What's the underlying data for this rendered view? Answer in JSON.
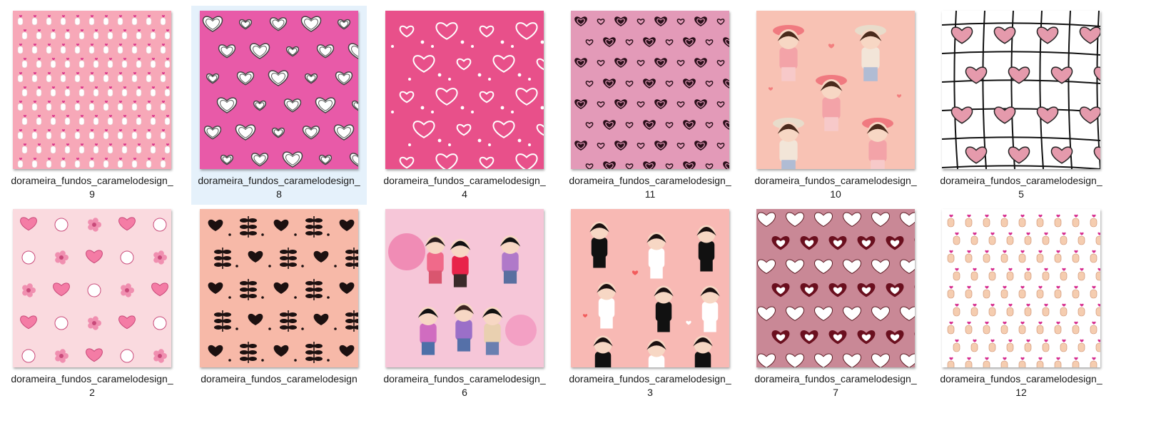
{
  "files": [
    {
      "name": "dorameira_fundos_caramelodesign_",
      "suffix": "9",
      "pattern": "finger-hearts-pink",
      "bg": "#f7a8b8",
      "selected": false
    },
    {
      "name": "dorameira_fundos_caramelodesign_",
      "suffix": "8",
      "pattern": "outline-hearts-magenta",
      "bg": "#e85aa8",
      "selected": true
    },
    {
      "name": "dorameira_fundos_caramelodesign_",
      "suffix": "4",
      "pattern": "white-line-hearts",
      "bg": "#e8508a",
      "selected": false
    },
    {
      "name": "dorameira_fundos_caramelodesign_",
      "suffix": "11",
      "pattern": "black-hearts-pink",
      "bg": "#e39ab8",
      "selected": false
    },
    {
      "name": "dorameira_fundos_caramelodesign_",
      "suffix": "10",
      "pattern": "chibi-couple",
      "bg": "#f8c2b4",
      "selected": false
    },
    {
      "name": "dorameira_fundos_caramelodesign_",
      "suffix": "5",
      "pattern": "grid-pink-hearts",
      "bg": "#ffffff",
      "selected": false
    },
    {
      "name": "dorameira_fundos_caramelodesign_",
      "suffix": "2",
      "pattern": "doodle-hearts-flowers",
      "bg": "#fadadf",
      "selected": false
    },
    {
      "name": "dorameira_fundos_caramelodesign",
      "suffix": "",
      "pattern": "black-doodle-hearts",
      "bg": "#f7b9a8",
      "selected": false
    },
    {
      "name": "dorameira_fundos_caramelodesign_",
      "suffix": "6",
      "pattern": "anime-couples-park",
      "bg": "#f6c6d8",
      "selected": false
    },
    {
      "name": "dorameira_fundos_caramelodesign_",
      "suffix": "3",
      "pattern": "wedding-couples",
      "bg": "#f8b9b4",
      "selected": false
    },
    {
      "name": "dorameira_fundos_caramelodesign_",
      "suffix": "7",
      "pattern": "white-maroon-hearts",
      "bg": "#c98896",
      "selected": false
    },
    {
      "name": "dorameira_fundos_caramelodesign_",
      "suffix": "12",
      "pattern": "finger-hearts-white",
      "bg": "#ffffff",
      "selected": false
    }
  ]
}
